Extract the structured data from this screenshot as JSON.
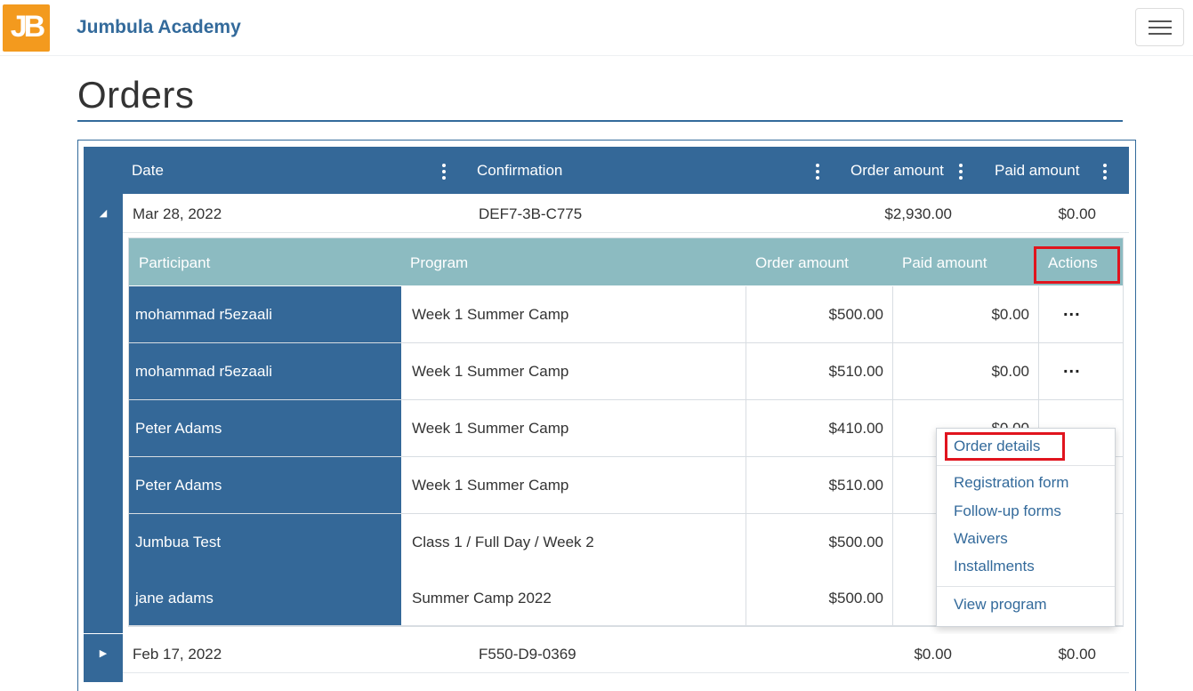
{
  "app": {
    "logo_text": "JB",
    "brand": "Jumbula Academy"
  },
  "page": {
    "title": "Orders"
  },
  "grid": {
    "columns": [
      "Date",
      "Confirmation",
      "Order amount",
      "Paid amount"
    ],
    "orders": [
      {
        "date": "Mar 28, 2022",
        "confirmation": "DEF7-3B-C775",
        "order_amount": "$2,930.00",
        "paid_amount": "$0.00",
        "expanded": true
      },
      {
        "date": "Feb 17, 2022",
        "confirmation": "F550-D9-0369",
        "order_amount": "$0.00",
        "paid_amount": "$0.00",
        "expanded": false
      }
    ]
  },
  "detail": {
    "columns": [
      "Participant",
      "Program",
      "Order amount",
      "Paid amount",
      "Actions"
    ],
    "rows": [
      {
        "participant": "mohammad r5ezaali",
        "program": "Week 1 Summer Camp",
        "order_amount": "$500.00",
        "paid_amount": "$0.00",
        "actions": "..."
      },
      {
        "participant": "mohammad r5ezaali",
        "program": "Week 1 Summer Camp",
        "order_amount": "$510.00",
        "paid_amount": "$0.00",
        "actions": "..."
      },
      {
        "participant": "Peter Adams",
        "program": "Week 1 Summer Camp",
        "order_amount": "$410.00",
        "paid_amount": "$0.00"
      },
      {
        "participant": "Peter Adams",
        "program": "Week 1 Summer Camp",
        "order_amount": "$510.00"
      },
      {
        "participant": "Jumbua Test",
        "program": "Class 1 / Full Day / Week 2",
        "order_amount": "$500.00"
      },
      {
        "participant": "jane adams",
        "program": "Summer Camp 2022",
        "order_amount": "$500.00"
      }
    ]
  },
  "actions_menu": {
    "items": [
      "Order details",
      "Registration form",
      "Follow-up forms",
      "Waivers",
      "Installments",
      "View program"
    ]
  },
  "colors": {
    "primary": "#346898",
    "detail_header": "#8cbbc1",
    "logo": "#f39a1e",
    "highlight": "#e0141e"
  }
}
